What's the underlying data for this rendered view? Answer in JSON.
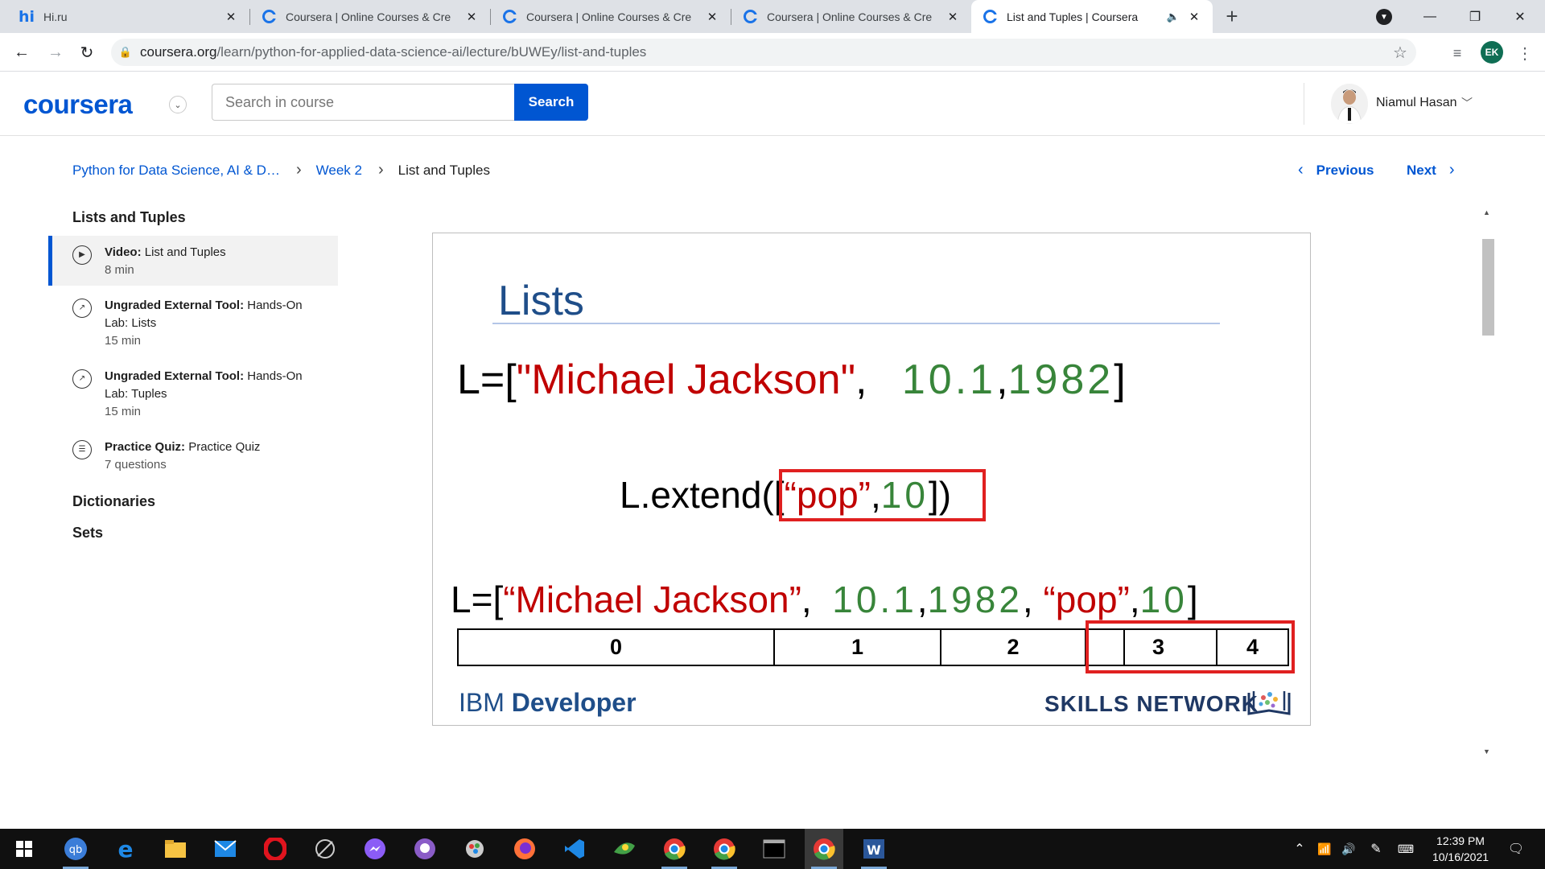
{
  "browser": {
    "tabs": [
      {
        "title": "Hi.ru",
        "favicon": "hi-icon",
        "active": false
      },
      {
        "title": "Coursera | Online Courses & Cre",
        "favicon": "coursera-icon",
        "active": false
      },
      {
        "title": "Coursera | Online Courses & Cre",
        "favicon": "coursera-icon",
        "active": false
      },
      {
        "title": "Coursera | Online Courses & Cre",
        "favicon": "coursera-icon",
        "active": false
      },
      {
        "title": "List and Tuples | Coursera",
        "favicon": "coursera-icon",
        "active": true,
        "audio": true
      }
    ],
    "url_host": "coursera.org",
    "url_path": "/learn/python-for-applied-data-science-ai/lecture/bUWEy/list-and-tuples",
    "profile_initials": "EK"
  },
  "header": {
    "logo": "coursera",
    "search_placeholder": "Search in course",
    "search_button": "Search",
    "user_name": "Niamul Hasan"
  },
  "breadcrumb": {
    "course": "Python for Data Science, AI & D…",
    "week": "Week 2",
    "current": "List and Tuples"
  },
  "nav": {
    "previous": "Previous",
    "next": "Next"
  },
  "sidebar": {
    "section1": "Lists and Tuples",
    "items": [
      {
        "type": "Video:",
        "name": "List and Tuples",
        "line2": "",
        "meta": "8 min",
        "icon": "play-icon"
      },
      {
        "type": "Ungraded External Tool:",
        "name": "Hands-On",
        "line2": "Lab: Lists",
        "meta": "15 min",
        "icon": "external-link-icon"
      },
      {
        "type": "Ungraded External Tool:",
        "name": "Hands-On",
        "line2": "Lab: Tuples",
        "meta": "15 min",
        "icon": "external-link-icon"
      },
      {
        "type": "Practice Quiz:",
        "name": "Practice Quiz",
        "line2": "",
        "meta": "7 questions",
        "icon": "quiz-icon"
      }
    ],
    "section2": "Dictionaries",
    "section3": "Sets"
  },
  "slide": {
    "title": "Lists",
    "line1": {
      "prefix": "L=[",
      "str": "\"Michael Jackson\"",
      "sep": ", ",
      "num1": "10.1",
      "comma": ",",
      "num2": "1982",
      "suffix": "]"
    },
    "line2": {
      "prefix": "L.extend([",
      "str": "“pop”",
      "comma": ",",
      "num": "10",
      "suffix": "])"
    },
    "line3": {
      "prefix": "L=[",
      "str": "“Michael Jackson”",
      "sep": ", ",
      "num1": "10.1",
      "c1": ",",
      "num2": "1982",
      "c2": ", ",
      "str2": "“pop”",
      "c3": ",",
      "num3": "10",
      "suffix": "]"
    },
    "indices": [
      "0",
      "1",
      "2",
      "3",
      "4"
    ],
    "brand_left_light": "IBM",
    "brand_left_bold": "Developer",
    "brand_right": "SKILLS NETWORK"
  },
  "taskbar": {
    "time": "12:39 PM",
    "date": "10/16/2021"
  },
  "colors": {
    "coursera_blue": "#0056d2",
    "slide_red": "#c00000",
    "slide_green": "#38853a",
    "highlight_red": "#e02020"
  }
}
